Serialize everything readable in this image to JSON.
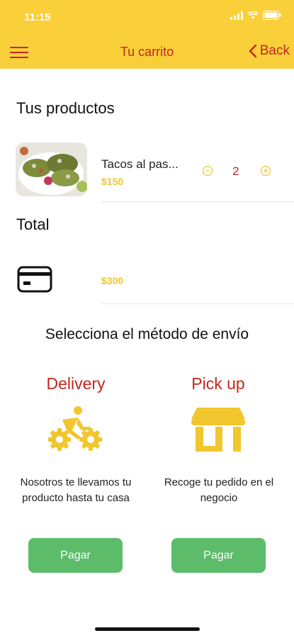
{
  "status_bar": {
    "time": "11:15"
  },
  "nav": {
    "title": "Tu carrito",
    "back_label": "Back"
  },
  "cart": {
    "section_title": "Tus productos",
    "items": [
      {
        "name": "Tacos al pas...",
        "price": "$150",
        "quantity": "2"
      }
    ],
    "total_label": "Total",
    "total_value": "$300"
  },
  "shipping": {
    "title": "Selecciona el método de envío",
    "options": [
      {
        "title": "Delivery",
        "description": "Nosotros te llevamos tu producto hasta tu casa",
        "button_label": "Pagar",
        "icon": "bicycle-icon"
      },
      {
        "title": "Pick up",
        "description": "Recoge tu pedido en el negocio",
        "button_label": "Pagar",
        "icon": "store-icon"
      }
    ]
  },
  "colors": {
    "header_bg": "#f9cf3a",
    "accent_red": "#c2271f",
    "price_yellow": "#f1c62e",
    "button_green": "#5cbc6a"
  }
}
